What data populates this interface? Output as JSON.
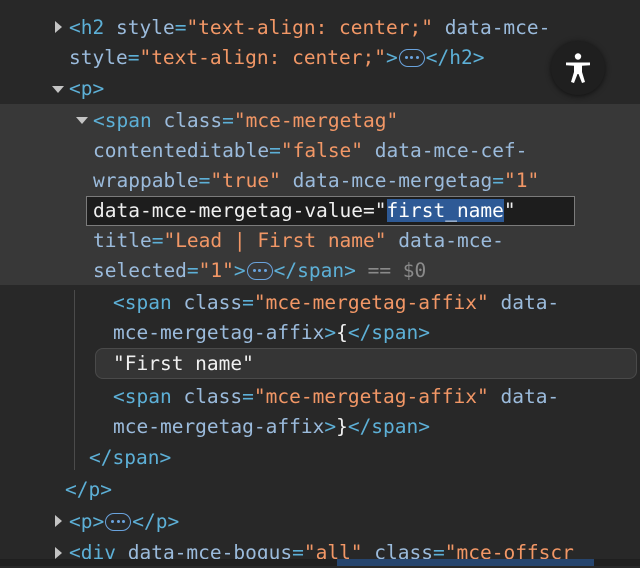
{
  "lines": [
    {
      "text": "<h2 style=\"text-align: center;\" data-mce-"
    },
    {
      "text": "style=\"text-align: center;\">"
    },
    {
      "text": "<p>"
    },
    {
      "text": "<span class=\"mce-mergetag\""
    },
    {
      "text": "contenteditable=\"false\" data-mce-cef-"
    },
    {
      "text": "wrappable=\"true\" data-mce-mergetag=\"1\""
    },
    {
      "text": "data-mce-mergetag-value=\"first_name\""
    },
    {
      "text": "title=\"Lead | First name\" data-mce-"
    },
    {
      "text": "selected=\"1\">"
    },
    {
      "text": "<span class=\"mce-mergetag-affix\" data-"
    },
    {
      "text": "mce-mergetag-affix>{</span>"
    },
    {
      "text": "\"First name\""
    },
    {
      "text": "<span class=\"mce-mergetag-affix\" data-"
    },
    {
      "text": "mce-mergetag-affix>}</span>"
    },
    {
      "text": "</span>"
    },
    {
      "text": "</p>"
    },
    {
      "text": "<p>"
    },
    {
      "text": "<div data-mce-bogus=\"all\" class=\"mce-offscr"
    }
  ],
  "tokens": {
    "h2_close": "</h2>",
    "span_close": "</span>",
    "p_close": "</p>",
    "eq_dollar": " == $0"
  },
  "colors": {
    "background": "#282828",
    "tag": "#5db0d7",
    "attr_name": "#9bbbdc",
    "attr_value": "#f29766",
    "selection": "#2e5a96"
  },
  "icons": {
    "accessibility": "accessibility-person-icon",
    "expand": "caret-right-icon",
    "collapse": "caret-down-icon",
    "ellipsis": "ellipsis-icon"
  }
}
